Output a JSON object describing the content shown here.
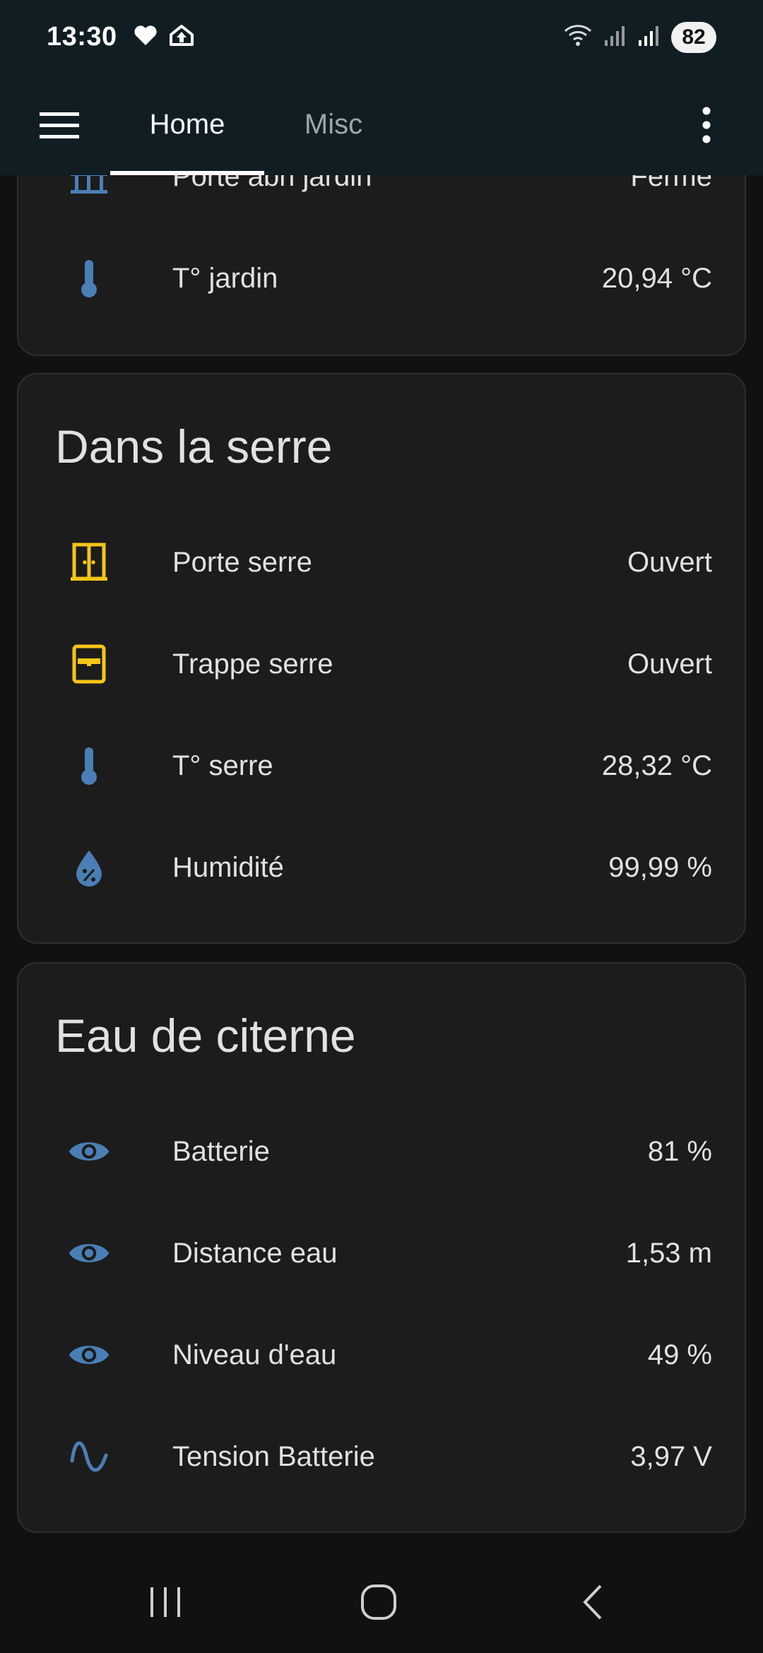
{
  "status_bar": {
    "time": "13:30",
    "battery": "82",
    "icons": [
      "heart-icon",
      "cloud-upload-icon",
      "wifi-icon",
      "signal-icon",
      "signal-icon"
    ]
  },
  "toolbar": {
    "tabs": [
      {
        "label": "Home",
        "active": true
      },
      {
        "label": "Misc",
        "active": false
      }
    ],
    "menu_icon": "hamburger-menu-icon",
    "overflow_icon": "more-vert-icon"
  },
  "cards": [
    {
      "title": "",
      "rows": [
        {
          "icon": "gate-icon",
          "label": "Porte abri jardin",
          "value": "Fermé"
        },
        {
          "icon": "thermometer-icon",
          "label": "T° jardin",
          "value": "20,94 °C"
        }
      ]
    },
    {
      "title": "Dans la serre",
      "rows": [
        {
          "icon": "door-open-icon",
          "label": "Porte serre",
          "value": "Ouvert"
        },
        {
          "icon": "window-open-icon",
          "label": "Trappe serre",
          "value": "Ouvert"
        },
        {
          "icon": "thermometer-icon",
          "label": "T° serre",
          "value": "28,32 °C"
        },
        {
          "icon": "water-percent-icon",
          "label": "Humidité",
          "value": "99,99 %"
        }
      ]
    },
    {
      "title": "Eau de citerne",
      "rows": [
        {
          "icon": "eye-icon",
          "label": "Batterie",
          "value": "81 %"
        },
        {
          "icon": "eye-icon",
          "label": "Distance eau",
          "value": "1,53 m"
        },
        {
          "icon": "eye-icon",
          "label": "Niveau d'eau",
          "value": "49 %"
        },
        {
          "icon": "sine-wave-icon",
          "label": "Tension Batterie",
          "value": "3,97 V"
        }
      ]
    }
  ],
  "colors": {
    "header_bg": "#101e24",
    "card_bg": "#1c1c1c",
    "icon_blue": "#4a7fb5",
    "icon_yellow": "#f5c518",
    "text": "#e1e1e1"
  },
  "nav_bar": {
    "buttons": [
      "recents-icon",
      "home-circle-icon",
      "back-chevron-icon"
    ]
  }
}
